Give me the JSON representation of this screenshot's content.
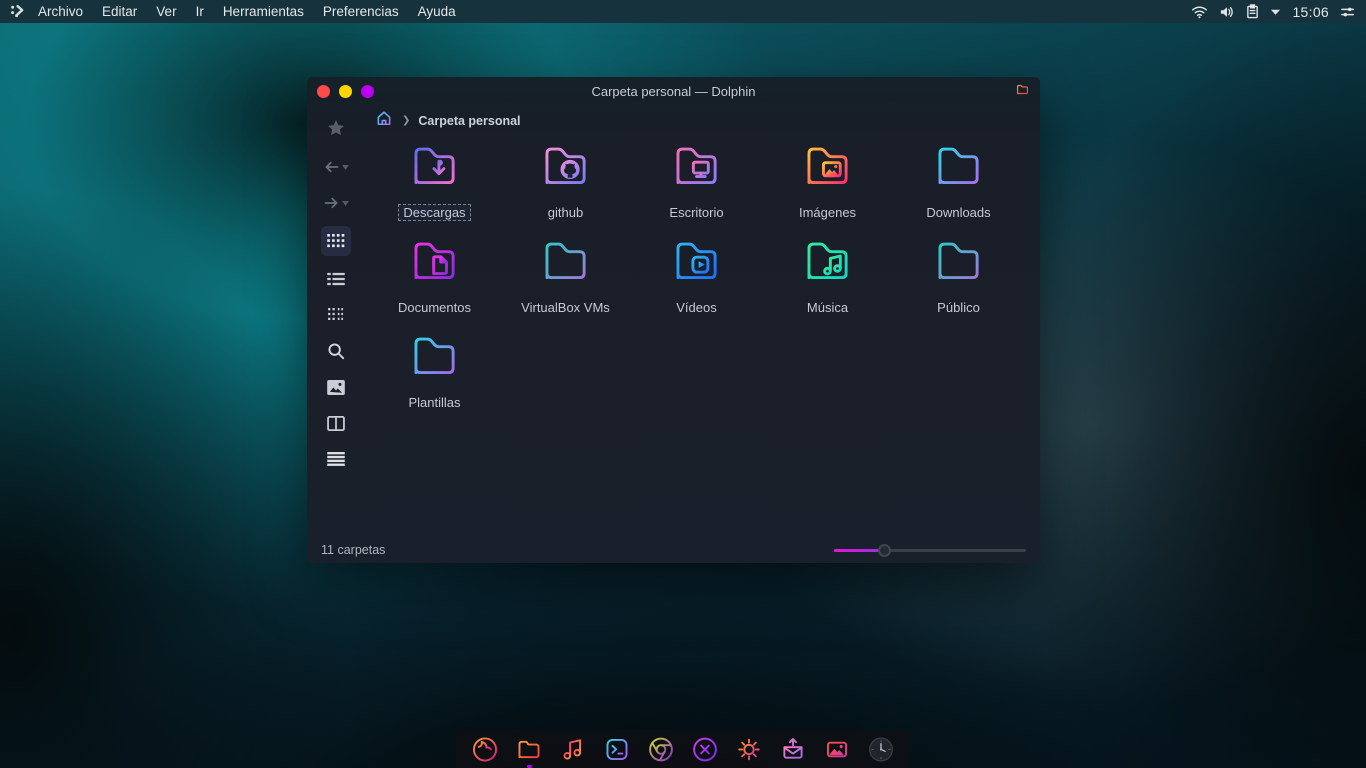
{
  "menubar": {
    "menus": [
      "Archivo",
      "Editar",
      "Ver",
      "Ir",
      "Herramientas",
      "Preferencias",
      "Ayuda"
    ],
    "clock": "15:06"
  },
  "window": {
    "title": "Carpeta personal — Dolphin",
    "breadcrumb": "Carpeta personal",
    "status": "11 carpetas"
  },
  "folders": [
    {
      "label": "Descargas",
      "glyph": "download",
      "c1": "#5f6cf0",
      "c2": "#f26fd0",
      "selected": true
    },
    {
      "label": "github",
      "glyph": "github",
      "c1": "#f28fd8",
      "c2": "#7f7bf2",
      "selected": false
    },
    {
      "label": "Escritorio",
      "glyph": "monitor",
      "c1": "#f56fb8",
      "c2": "#8f7af5",
      "selected": false
    },
    {
      "label": "Imágenes",
      "glyph": "image",
      "c1": "#ffc13a",
      "c2": "#ff2e6e",
      "selected": false
    },
    {
      "label": "Downloads",
      "glyph": "none",
      "c1": "#2fd4e8",
      "c2": "#a66ff0",
      "selected": false
    },
    {
      "label": "Documentos",
      "glyph": "doc",
      "c1": "#e832e8",
      "c2": "#8e2bd8",
      "selected": false
    },
    {
      "label": "VirtualBox VMs",
      "glyph": "none",
      "c1": "#2fc8c4",
      "c2": "#9d7ad8",
      "selected": false
    },
    {
      "label": "Vídeos",
      "glyph": "play",
      "c1": "#31b4f5",
      "c2": "#1f6ef5",
      "selected": false
    },
    {
      "label": "Música",
      "glyph": "note",
      "c1": "#35ec9a",
      "c2": "#0fd6c4",
      "selected": false
    },
    {
      "label": "Público",
      "glyph": "none",
      "c1": "#2fc8c4",
      "c2": "#9d7ad8",
      "selected": false
    },
    {
      "label": "Plantillas",
      "glyph": "none",
      "c1": "#2fd0ea",
      "c2": "#a668ec",
      "selected": false
    }
  ],
  "dock": [
    {
      "name": "firefox",
      "c1": "#ff9e2c",
      "c2": "#e0157a",
      "active": false
    },
    {
      "name": "file-manager",
      "c1": "#ff9e3d",
      "c2": "#f23d3d",
      "active": true
    },
    {
      "name": "music-player",
      "c1": "#ff3d66",
      "c2": "#ff9e2c",
      "active": false
    },
    {
      "name": "terminal",
      "c1": "#2fd4e8",
      "c2": "#a05ef0",
      "active": false
    },
    {
      "name": "chromium",
      "c1": "#cdd62e",
      "c2": "#8a2bd8",
      "active": false
    },
    {
      "name": "media-player",
      "c1": "#d03df0",
      "c2": "#7a2bf0",
      "active": false
    },
    {
      "name": "settings",
      "c1": "#ff8c2a",
      "c2": "#e03a8c",
      "active": false
    },
    {
      "name": "mail",
      "c1": "#ff7ab8",
      "c2": "#a06af0",
      "active": false
    },
    {
      "name": "photos",
      "c1": "#ff4d4d",
      "c2": "#d83aa0",
      "active": false
    },
    {
      "name": "clock",
      "c1": "#3a3e48",
      "c2": "#3a3e48",
      "active": false
    }
  ],
  "colors": {
    "accent": "#b400e6",
    "traffic_red": "#ff4a4a",
    "traffic_yellow": "#ffd400",
    "traffic_purple": "#bb00f0"
  }
}
